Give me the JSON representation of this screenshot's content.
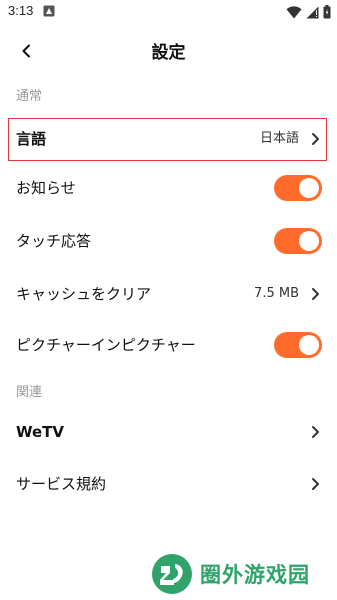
{
  "status_bar": {
    "time": "3:13",
    "icons": [
      "notification-icon",
      "wifi-icon",
      "signal-icon",
      "battery-icon"
    ]
  },
  "header": {
    "title": "設定",
    "back_icon": "back-arrow-icon"
  },
  "sections": {
    "general": {
      "header": "通常",
      "items": [
        {
          "label": "言語",
          "value": "日本語",
          "type": "link"
        },
        {
          "label": "お知らせ",
          "type": "toggle",
          "on": true
        },
        {
          "label": "タッチ応答",
          "type": "toggle",
          "on": true
        },
        {
          "label": "キャッシュをクリア",
          "value": "7.5 MB",
          "type": "link"
        },
        {
          "label": "ピクチャーインピクチャー",
          "type": "toggle",
          "on": true
        }
      ]
    },
    "related": {
      "header": "関連",
      "items": [
        {
          "label": "WeTV",
          "type": "link"
        },
        {
          "label": "サービス規約",
          "type": "link"
        }
      ]
    }
  },
  "watermark": {
    "text": "圈外游戏园",
    "icon": "logo-icon"
  },
  "colors": {
    "accent": "#ff6b2b",
    "highlight": "#e03a3a",
    "section_header": "#9a9a9a",
    "watermark": "#2fa36a"
  }
}
